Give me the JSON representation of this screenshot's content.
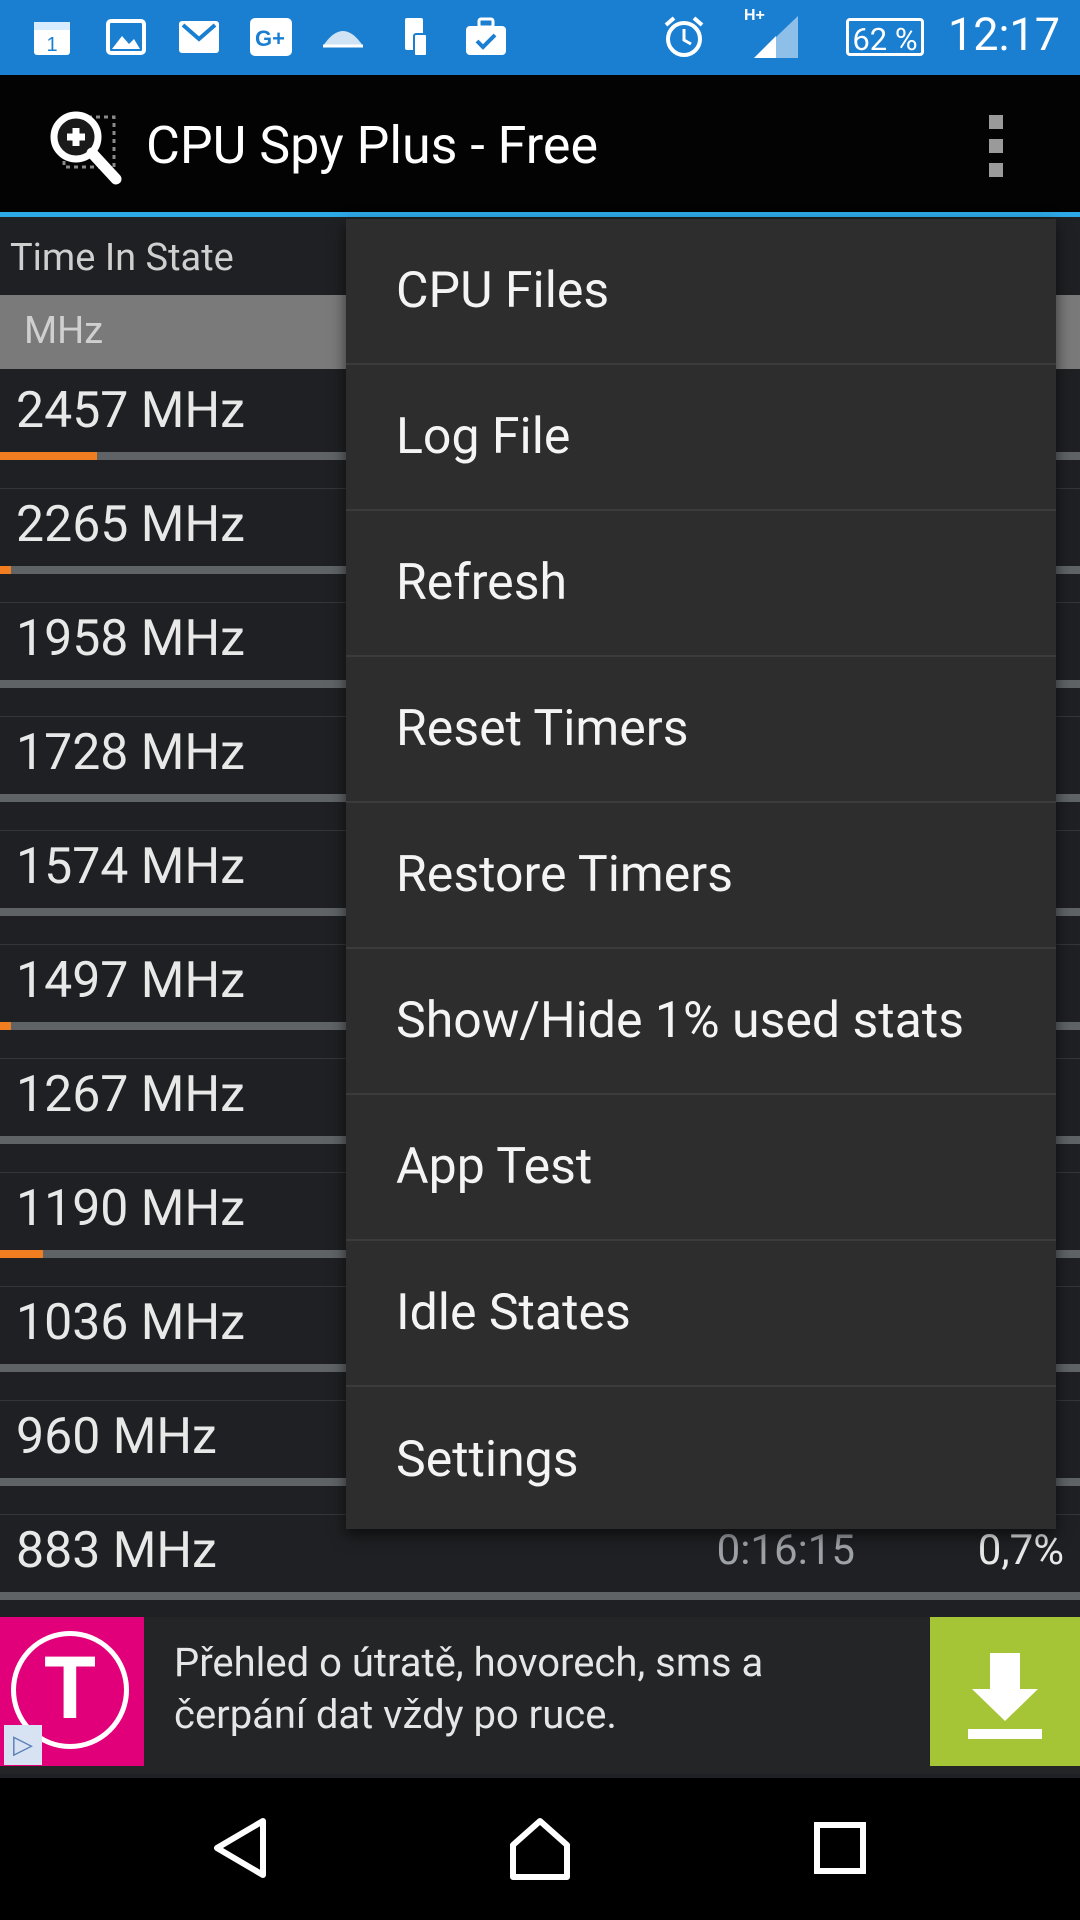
{
  "status_bar": {
    "time": "12:17",
    "battery": "62 %",
    "network": "H+",
    "calendar_day": "1",
    "icons": [
      "calendar-icon",
      "gallery-icon",
      "gmail-icon",
      "google-plus-icon",
      "game-icon",
      "phone-device-icon",
      "briefcase-check-icon",
      "alarm-icon",
      "signal-icon",
      "battery-icon"
    ]
  },
  "app_bar": {
    "title": "CPU Spy Plus - Free",
    "icon": "cpu-magnifier-icon",
    "overflow_icon": "overflow-menu-icon"
  },
  "content": {
    "section_title": "Time In State",
    "column_header": "MHz",
    "rows": [
      {
        "freq": "2457 MHz",
        "time": "",
        "percent": "",
        "progress": 9
      },
      {
        "freq": "2265 MHz",
        "time": "",
        "percent": "",
        "progress": 1
      },
      {
        "freq": "1958 MHz",
        "time": "",
        "percent": "",
        "progress": 0
      },
      {
        "freq": "1728 MHz",
        "time": "",
        "percent": "",
        "progress": 0
      },
      {
        "freq": "1574 MHz",
        "time": "",
        "percent": "",
        "progress": 0
      },
      {
        "freq": "1497 MHz",
        "time": "",
        "percent": "",
        "progress": 1
      },
      {
        "freq": "1267 MHz",
        "time": "",
        "percent": "",
        "progress": 0
      },
      {
        "freq": "1190 MHz",
        "time": "",
        "percent": "",
        "progress": 4
      },
      {
        "freq": "1036 MHz",
        "time": "",
        "percent": "",
        "progress": 0
      },
      {
        "freq": "960 MHz",
        "time": "",
        "percent": "",
        "progress": 0
      },
      {
        "freq": "883 MHz",
        "time": "0:16:15",
        "percent": "0,7%",
        "progress": 0
      }
    ]
  },
  "overflow_menu": {
    "items": [
      "CPU Files",
      "Log File",
      "Refresh",
      "Reset Timers",
      "Restore Timers",
      "Show/Hide 1% used stats",
      "App Test",
      "Idle States",
      "Settings"
    ]
  },
  "ad": {
    "brand_letter": "T",
    "text_line1": "Přehled o útratě, hovorech, sms a",
    "text_line2": "čerpání dat vždy po ruce.",
    "brand_color": "#e2007a",
    "cta_color": "#a5c436",
    "cta_icon": "download-icon",
    "adchoices_icon": "adchoices-icon"
  },
  "nav_bar": {
    "icons": [
      "back-icon",
      "home-icon",
      "recents-icon"
    ]
  },
  "colors": {
    "status_bar": "#1b7fd1",
    "accent_line": "#2ea9e8",
    "progress": "#f07e20",
    "menu_bg": "#2d2d2d"
  }
}
